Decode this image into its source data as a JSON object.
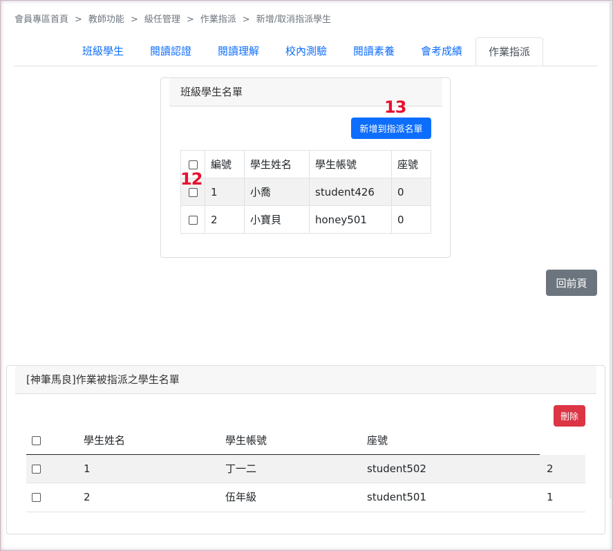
{
  "breadcrumb": [
    "會員專區首頁",
    "教師功能",
    "級任管理",
    "作業指派",
    "新增/取消指派學生"
  ],
  "tabs": [
    {
      "label": "班級學生"
    },
    {
      "label": "閱讀認證"
    },
    {
      "label": "閱讀理解"
    },
    {
      "label": "校內測驗"
    },
    {
      "label": "閱讀素養"
    },
    {
      "label": "會考成績"
    },
    {
      "label": "作業指派",
      "active": true
    }
  ],
  "class_list": {
    "header": "班級學生名單",
    "add_button": "新增到指派名單",
    "columns": [
      "編號",
      "學生姓名",
      "學生帳號",
      "座號"
    ],
    "rows": [
      {
        "no": "1",
        "name": "小喬",
        "account": "student426",
        "seat": "0"
      },
      {
        "no": "2",
        "name": "小寶貝",
        "account": "honey501",
        "seat": "0"
      }
    ]
  },
  "annotations": {
    "mark_add": "13",
    "mark_checkbox": "12"
  },
  "back_button": "回前頁",
  "assigned_list": {
    "header": "[神筆馬良]作業被指派之學生名單",
    "delete_button": "刪除",
    "columns": [
      "學生姓名",
      "學生帳號",
      "座號"
    ],
    "rows": [
      {
        "no": "1",
        "name": "丁一二",
        "account": "student502",
        "seat": "2"
      },
      {
        "no": "2",
        "name": "伍年級",
        "account": "student501",
        "seat": "1"
      }
    ]
  },
  "colors": {
    "primary": "#0d6efd",
    "secondary": "#6c757d",
    "danger": "#dc3545",
    "annotation": "#e8102e"
  }
}
